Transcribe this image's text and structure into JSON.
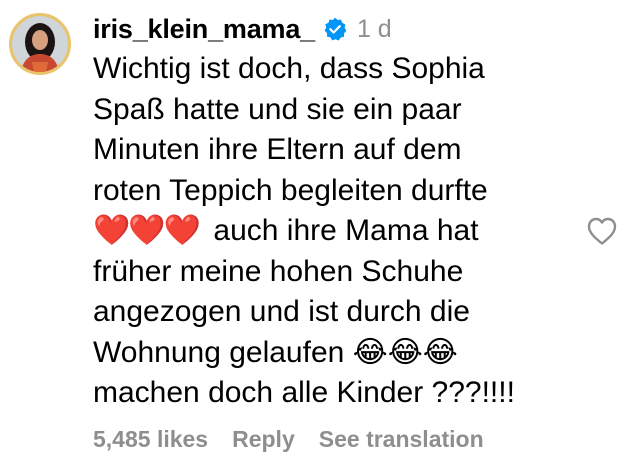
{
  "comment": {
    "username": "iris_klein_mama_",
    "time": "1 d",
    "text_lines": [
      "Wichtig ist doch, dass Sophia",
      "Spaß hatte und sie ein paar",
      "Minuten ihre Eltern auf dem",
      "roten Teppich begleiten durfte",
      "❤️❤️❤️",
      "auch ihre Mama hat",
      "früher meine hohen Schuhe",
      "angezogen und ist durch die",
      "Wohnung gelaufen",
      "😂😂😂",
      "machen doch alle Kinder ???!!!!"
    ],
    "likes": "5,485 likes",
    "reply_label": "Reply",
    "translate_label": "See translation",
    "avatar_icon": "profile-avatar",
    "verified_icon": "verified-badge-icon",
    "like_icon": "heart-outline-icon"
  },
  "colors": {
    "text": "#000000",
    "muted": "#8e8e8e",
    "verified": "#0095f6",
    "heart": "#e0245e"
  }
}
